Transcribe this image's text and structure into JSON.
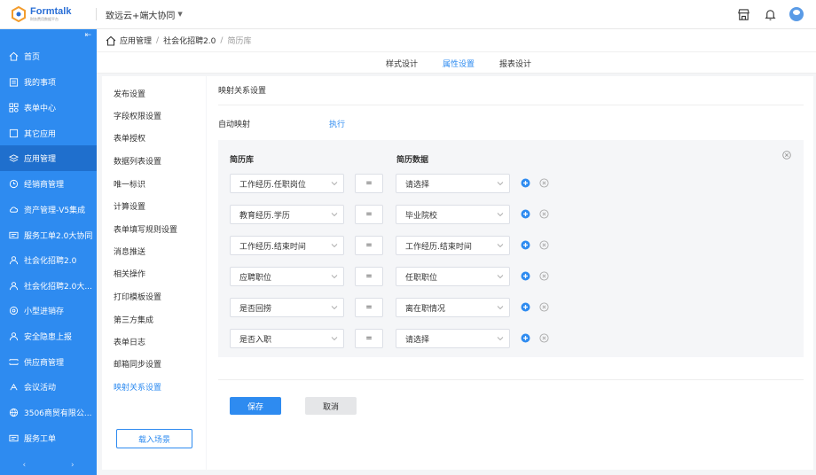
{
  "app": {
    "logo_name": "Formtalk",
    "logo_sub": "财务费用数据平台",
    "org": "致远云+端大协同"
  },
  "header_icons": [
    "store-icon",
    "bell-icon",
    "avatar"
  ],
  "sidebar": {
    "items": [
      {
        "label": "首页",
        "icon": "home-icon"
      },
      {
        "label": "我的事项",
        "icon": "calendar-icon"
      },
      {
        "label": "表单中心",
        "icon": "grid-icon"
      },
      {
        "label": "其它应用",
        "icon": "square-icon"
      },
      {
        "label": "应用管理",
        "icon": "layers-icon",
        "active": true
      },
      {
        "label": "经销商管理",
        "icon": "clock-icon"
      },
      {
        "label": "资产管理-V5集成",
        "icon": "cloud-icon"
      },
      {
        "label": "服务工单2.0大协同",
        "icon": "ticket-icon"
      },
      {
        "label": "社会化招聘2.0",
        "icon": "person-icon"
      },
      {
        "label": "社会化招聘2.0大...",
        "icon": "person-icon"
      },
      {
        "label": "小型进销存",
        "icon": "gear-icon"
      },
      {
        "label": "安全隐患上报",
        "icon": "person-icon"
      },
      {
        "label": "供应商管理",
        "icon": "box-icon"
      },
      {
        "label": "会议活动",
        "icon": "meeting-icon"
      },
      {
        "label": "3506商贸有限公...",
        "icon": "globe-icon"
      },
      {
        "label": "服务工单",
        "icon": "ticket-icon"
      }
    ]
  },
  "breadcrumb": {
    "items": [
      "应用管理",
      "社会化招聘2.0"
    ],
    "current": "简历库"
  },
  "tabs": [
    {
      "label": "样式设计"
    },
    {
      "label": "属性设置",
      "active": true
    },
    {
      "label": "报表设计"
    }
  ],
  "left_menu": {
    "items": [
      "发布设置",
      "字段权限设置",
      "表单授权",
      "数据列表设置",
      "唯一标识",
      "计算设置",
      "表单填写规则设置",
      "消息推送",
      "相关操作",
      "打印模板设置",
      "第三方集成",
      "表单日志",
      "邮箱同步设置",
      "映射关系设置"
    ],
    "active_index": 13,
    "load_button": "载入场景"
  },
  "main": {
    "title": "映射关系设置",
    "auto_map_label": "自动映射",
    "execute_link": "执行",
    "col_left": "简历库",
    "col_right": "简历数据",
    "eq_symbol": "=",
    "rows": [
      {
        "left": "工作经历.任职岗位",
        "right": "请选择"
      },
      {
        "left": "教育经历.学历",
        "right": "毕业院校"
      },
      {
        "left": "工作经历.结束时间",
        "right": "工作经历.结束时间"
      },
      {
        "left": "应聘职位",
        "right": "任职职位"
      },
      {
        "left": "是否回捞",
        "right": "离在职情况"
      },
      {
        "left": "是否入职",
        "right": "请选择"
      }
    ],
    "save": "保存",
    "cancel": "取消"
  },
  "colors": {
    "primary": "#2e8bf0",
    "sidebar_active": "#1f6fcd",
    "gray_bg": "#f4f5f7"
  }
}
